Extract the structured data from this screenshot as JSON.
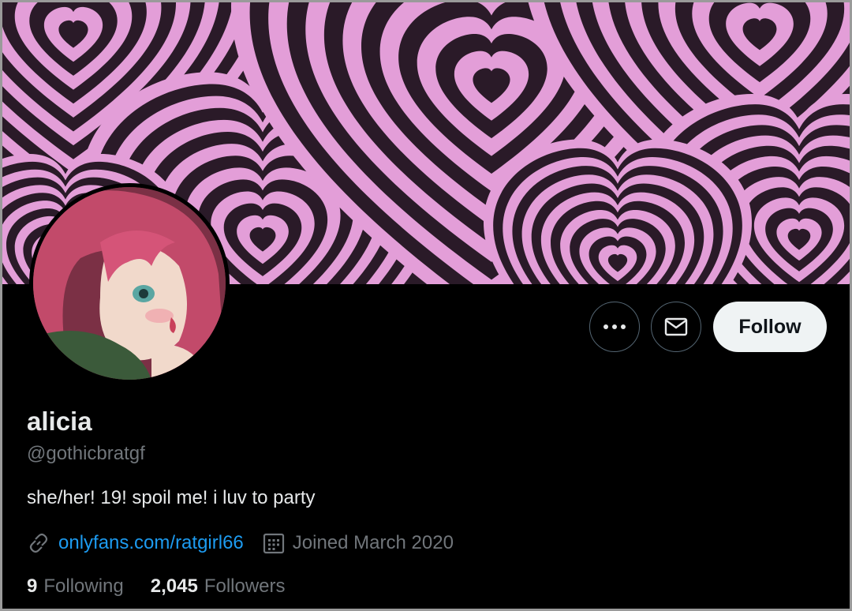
{
  "profile": {
    "display_name": "alicia",
    "handle": "@gothicbratgf",
    "bio": "she/her! 19! spoil me! i luv to party",
    "website": "onlyfans.com/ratgirl66",
    "joined": "Joined March 2020"
  },
  "actions": {
    "more_icon": "more-horizontal-icon",
    "message_icon": "mail-icon",
    "follow_label": "Follow"
  },
  "stats": {
    "following_count": "9",
    "following_label": "Following",
    "followers_count": "2,045",
    "followers_label": "Followers"
  },
  "colors": {
    "background": "#000000",
    "banner_pink": "#e39ed8",
    "banner_dark": "#2a1a28",
    "link": "#1d9bf0",
    "secondary_text": "#71767b",
    "primary_text": "#e7e9ea",
    "follow_bg": "#eff3f4"
  }
}
